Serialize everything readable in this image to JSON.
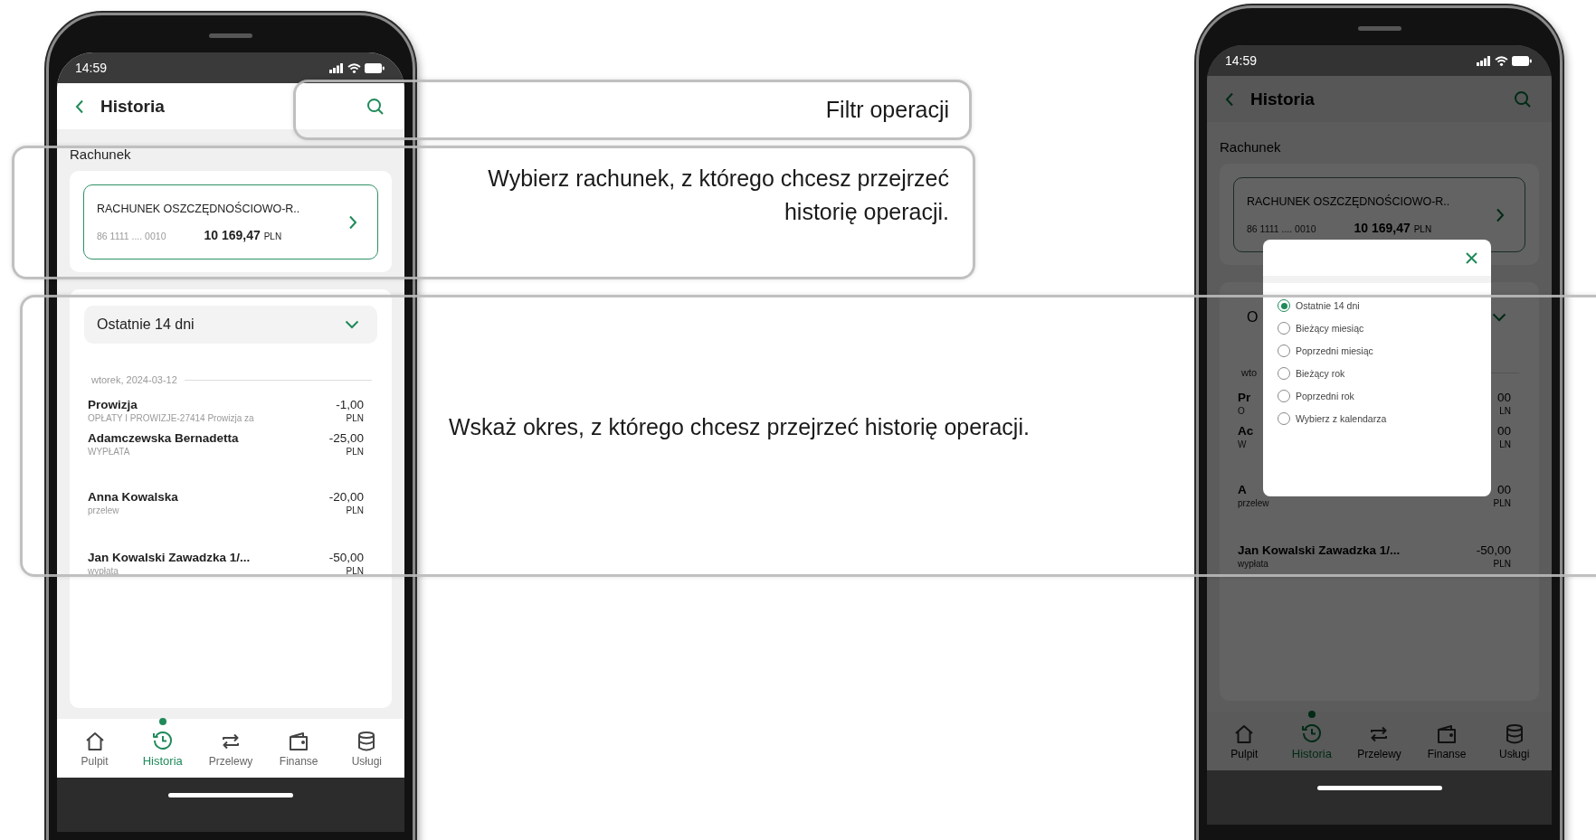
{
  "callouts": [
    {
      "kind": "filter",
      "text": "Filtr operacji"
    },
    {
      "kind": "account",
      "text": "Wybierz rachunek, z którego chcesz przejrzeć historię operacji."
    },
    {
      "kind": "period",
      "text": "Wskaż okres, z którego chcesz przejrzeć historię operacji."
    }
  ],
  "phones": [
    {
      "dimmed": false,
      "time": "14:59",
      "title": "Historia",
      "section_label": "Rachunek",
      "account": {
        "name": "RACHUNEK OSZCZĘDNOŚCIOWO-R..",
        "number": "86 1111 .... 0010",
        "balance": "10 169,47",
        "currency": "PLN"
      },
      "period": "Ostatnie 14 dni",
      "date": "wtorek, 2024-03-12",
      "transactions": [
        {
          "title": "Prowizja",
          "description": "OPŁATY I PROWIZJE-27414 Prowizja za",
          "amount": "-1,00",
          "currency": "PLN"
        },
        {
          "title": "Adamczewska Bernadetta",
          "description": "WYPŁATA",
          "amount": "-25,00",
          "currency": "PLN"
        },
        {
          "title": "Anna Kowalska",
          "description": "przelew",
          "amount": "-20,00",
          "currency": "PLN"
        },
        {
          "title": "Jan Kowalski Zawadzka 1/...",
          "description": "wypłata",
          "amount": "-50,00",
          "currency": "PLN"
        }
      ],
      "nav": [
        {
          "label": "Pulpit",
          "selected": false
        },
        {
          "label": "Historia",
          "selected": true
        },
        {
          "label": "Przelewy",
          "selected": false
        },
        {
          "label": "Finanse",
          "selected": false
        },
        {
          "label": "Usługi",
          "selected": false
        }
      ]
    },
    {
      "dimmed": true,
      "time": "14:59",
      "title": "Historia",
      "section_label": "Rachunek",
      "account": {
        "name": "RACHUNEK OSZCZĘDNOŚCIOWO-R..",
        "number": "86 1111 .... 0010",
        "balance": "10 169,47",
        "currency": "PLN"
      },
      "period": "O",
      "date": "wto",
      "transactions": [
        {
          "title": "Pr",
          "description": "O",
          "amount": "00",
          "currency": "LN"
        },
        {
          "title": "Ac",
          "description": "W",
          "amount": "00",
          "currency": "LN"
        },
        {
          "title": "A",
          "description": "przelew",
          "amount": "00",
          "currency": "PLN"
        },
        {
          "title": "Jan Kowalski Zawadzka 1/...",
          "description": "wypłata",
          "amount": "-50,00",
          "currency": "PLN"
        }
      ],
      "nav": [
        {
          "label": "Pulpit",
          "selected": false
        },
        {
          "label": "Historia",
          "selected": true
        },
        {
          "label": "Przelewy",
          "selected": false
        },
        {
          "label": "Finanse",
          "selected": false
        },
        {
          "label": "Usługi",
          "selected": false
        }
      ],
      "dialog": {
        "options": [
          {
            "label": "Ostatnie 14 dni",
            "selected": true
          },
          {
            "label": "Bieżący miesiąc",
            "selected": false
          },
          {
            "label": "Poprzedni miesiąc",
            "selected": false
          },
          {
            "label": "Bieżący rok",
            "selected": false
          },
          {
            "label": "Poprzedni rok",
            "selected": false
          },
          {
            "label": "Wybierz z kalendarza",
            "selected": false
          }
        ]
      }
    }
  ]
}
